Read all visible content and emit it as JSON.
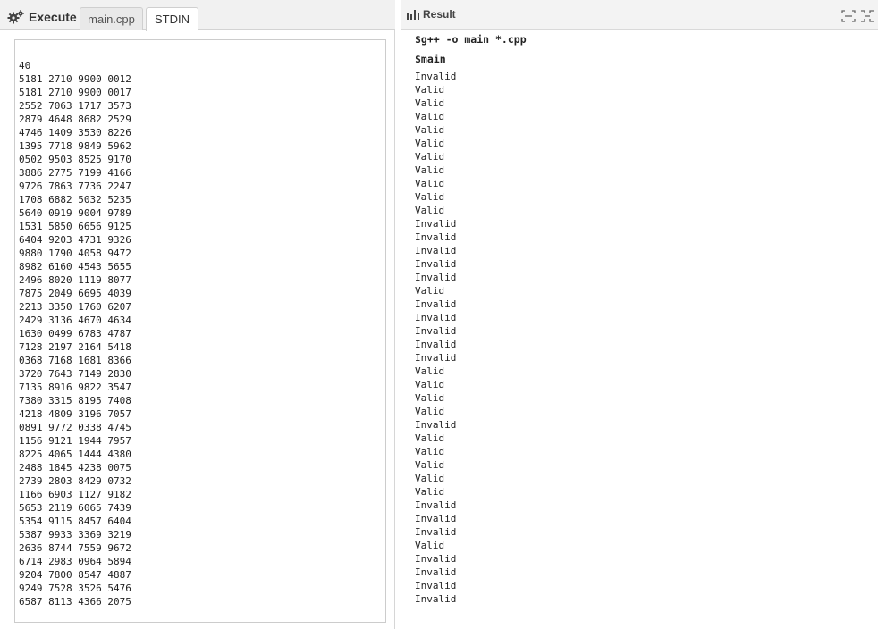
{
  "editor": {
    "execute_label": "Execute",
    "tabs": [
      {
        "label": "main.cpp",
        "active": false
      },
      {
        "label": "STDIN",
        "active": true
      }
    ],
    "stdin_text": "40\n5181 2710 9900 0012\n5181 2710 9900 0017\n2552 7063 1717 3573\n2879 4648 8682 2529\n4746 1409 3530 8226\n1395 7718 9849 5962\n0502 9503 8525 9170\n3886 2775 7199 4166\n9726 7863 7736 2247\n1708 6882 5032 5235\n5640 0919 9004 9789\n1531 5850 6656 9125\n6404 9203 4731 9326\n9880 1790 4058 9472\n8982 6160 4543 5655\n2496 8020 1119 8077\n7875 2049 6695 4039\n2213 3350 1760 6207\n2429 3136 4670 4634\n1630 0499 6783 4787\n7128 2197 2164 5418\n0368 7168 1681 8366\n3720 7643 7149 2830\n7135 8916 9822 3547\n7380 3315 8195 7408\n4218 4809 3196 7057\n0891 9772 0338 4745\n1156 9121 1944 7957\n8225 4065 1444 4380\n2488 1845 4238 0075\n2739 2803 8429 0732\n1166 6903 1127 9182\n5653 2119 6065 7439\n5354 9115 8457 6404\n5387 9933 3369 3219\n2636 8744 7559 9672\n6714 2983 0964 5894\n9204 7800 8547 4887\n9249 7528 3526 5476\n6587 8113 4366 2075"
  },
  "result": {
    "title": "Result",
    "compile_cmd": "$g++ -o main *.cpp",
    "run_cmd": "$main",
    "output_text": "Invalid\nValid\nValid\nValid\nValid\nValid\nValid\nValid\nValid\nValid\nValid\nInvalid\nInvalid\nInvalid\nInvalid\nInvalid\nValid\nInvalid\nInvalid\nInvalid\nInvalid\nInvalid\nValid\nValid\nValid\nValid\nInvalid\nValid\nValid\nValid\nValid\nValid\nInvalid\nInvalid\nInvalid\nValid\nInvalid\nInvalid\nInvalid\nInvalid"
  },
  "colors": {
    "tabbar_bg": "#f1f1f1",
    "border": "#cccccc",
    "text": "#222222"
  },
  "icons": {
    "execute": "gear-icon",
    "result": "bar-chart-icon",
    "expand": "expand-icon",
    "collapse": "collapse-icon"
  }
}
